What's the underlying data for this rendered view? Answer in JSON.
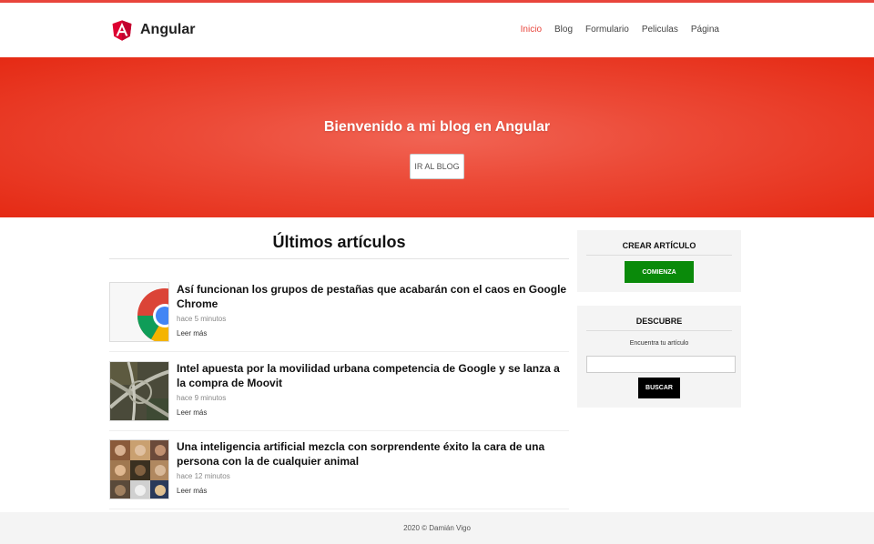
{
  "brand": {
    "name": "Angular",
    "color": "#dd0031"
  },
  "nav": {
    "items": [
      {
        "label": "Inicio",
        "active": true
      },
      {
        "label": "Blog",
        "active": false
      },
      {
        "label": "Formulario",
        "active": false
      },
      {
        "label": "Peliculas",
        "active": false
      },
      {
        "label": "Página",
        "active": false
      }
    ]
  },
  "hero": {
    "title": "Bienvenido a mi blog en Angular",
    "button_label": "IR AL BLOG"
  },
  "main": {
    "title": "Últimos artículos",
    "articles": [
      {
        "title": "Así funcionan los grupos de pestañas que acabarán con el caos en Google Chrome",
        "date": "hace 5 minutos",
        "more": "Leer más",
        "thumb": "chrome-logo"
      },
      {
        "title": "Intel apuesta por la movilidad urbana competencia de Google y se lanza a la compra de Moovit",
        "date": "hace 9 minutos",
        "more": "Leer más",
        "thumb": "highway-aerial"
      },
      {
        "title": "Una inteligencia artificial mezcla con sorprendente éxito la cara de una persona con la de cualquier animal",
        "date": "hace 12 minutos",
        "more": "Leer más",
        "thumb": "face-grid"
      }
    ]
  },
  "sidebar": {
    "create": {
      "title": "CREAR ARTÍCULO",
      "button_label": "COMIENZA"
    },
    "discover": {
      "title": "DESCUBRE",
      "label": "Encuentra tu artículo",
      "input_value": "",
      "button_label": "BUSCAR"
    }
  },
  "footer": {
    "text": "2020 © Damián Vigo"
  },
  "colors": {
    "accent": "#e8453c",
    "green": "#0a8a0a"
  }
}
